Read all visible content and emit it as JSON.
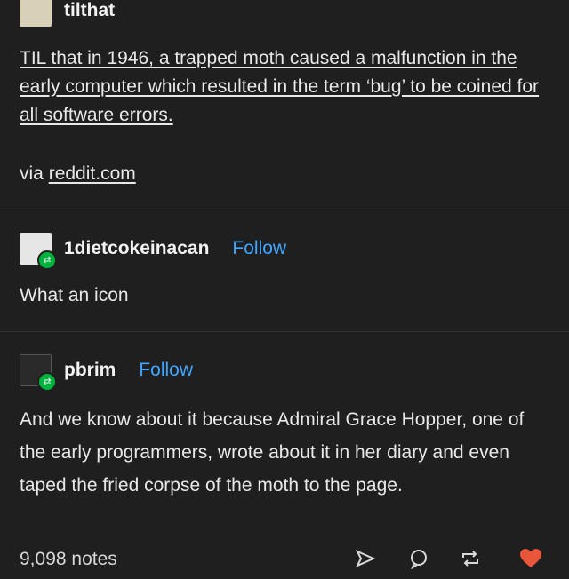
{
  "post1": {
    "username": "tilthat",
    "text": "TIL that in 1946, a trapped moth caused a malfunction in the early computer which resulted in the term ‘bug’ to be coined for all software errors.",
    "via_prefix": "via",
    "via_link": "reddit.com"
  },
  "post2": {
    "username": "1dietcokeinacan",
    "follow_label": "Follow",
    "text": "What an icon"
  },
  "post3": {
    "username": "pbrim",
    "follow_label": "Follow",
    "text": "And we know about it because Admiral Grace Hopper, one of the early programmers, wrote about it in her diary and even taped the fried corpse of the moth to the page."
  },
  "footer": {
    "notes": "9,098 notes"
  },
  "colors": {
    "background": "#1f1f1f",
    "follow": "#3ea6ff",
    "reblog_badge": "#00b33c",
    "heart": "#e8563c"
  },
  "icons": [
    "share-icon",
    "reply-icon",
    "reblog-icon",
    "heart-icon"
  ]
}
